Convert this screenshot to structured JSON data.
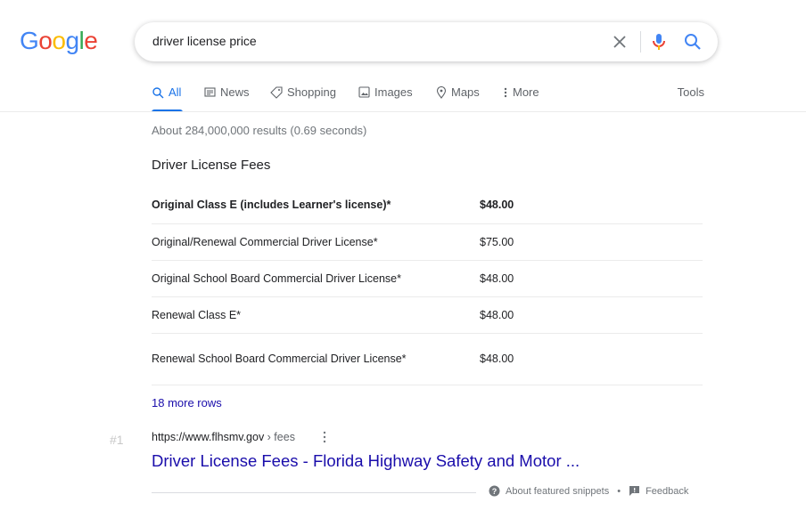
{
  "logo": {
    "letters": [
      "G",
      "o",
      "o",
      "g",
      "l",
      "e"
    ],
    "colors": [
      "#4285F4",
      "#EA4335",
      "#FBBC05",
      "#4285F4",
      "#34A853",
      "#EA4335"
    ]
  },
  "search": {
    "query": "driver license price",
    "icons": [
      "close-icon",
      "mic-icon",
      "search-icon"
    ]
  },
  "tabs": [
    {
      "label": "All",
      "icon": "search-icon",
      "active": true
    },
    {
      "label": "News",
      "icon": "news-icon"
    },
    {
      "label": "Shopping",
      "icon": "tag-icon"
    },
    {
      "label": "Images",
      "icon": "image-icon"
    },
    {
      "label": "Maps",
      "icon": "map-pin-icon"
    },
    {
      "label": "More",
      "icon": "kebab-icon"
    }
  ],
  "tools_label": "Tools",
  "stats": "About 284,000,000 results (0.69 seconds)",
  "snippet": {
    "title": "Driver License Fees",
    "rows": [
      {
        "name": "Original Class E (includes Learner's license)*",
        "price": "$48.00"
      },
      {
        "name": "Original/Renewal Commercial Driver License*",
        "price": "$75.00"
      },
      {
        "name": "Original School Board Commercial Driver License*",
        "price": "$48.00"
      },
      {
        "name": "Renewal Class E*",
        "price": "$48.00"
      },
      {
        "name": "Renewal School Board Commercial Driver License*",
        "price": "$48.00"
      }
    ],
    "more_rows": "18 more rows"
  },
  "result": {
    "rank": "#1",
    "domain": "https://www.flhsmv.gov",
    "path": " › fees",
    "title": "Driver License Fees - Florida Highway Safety and Motor ..."
  },
  "footer": {
    "about": "About featured snippets",
    "separator": "•",
    "feedback": "Feedback"
  },
  "colors": {
    "link": "#1a0dab",
    "accent": "#1a73e8"
  }
}
